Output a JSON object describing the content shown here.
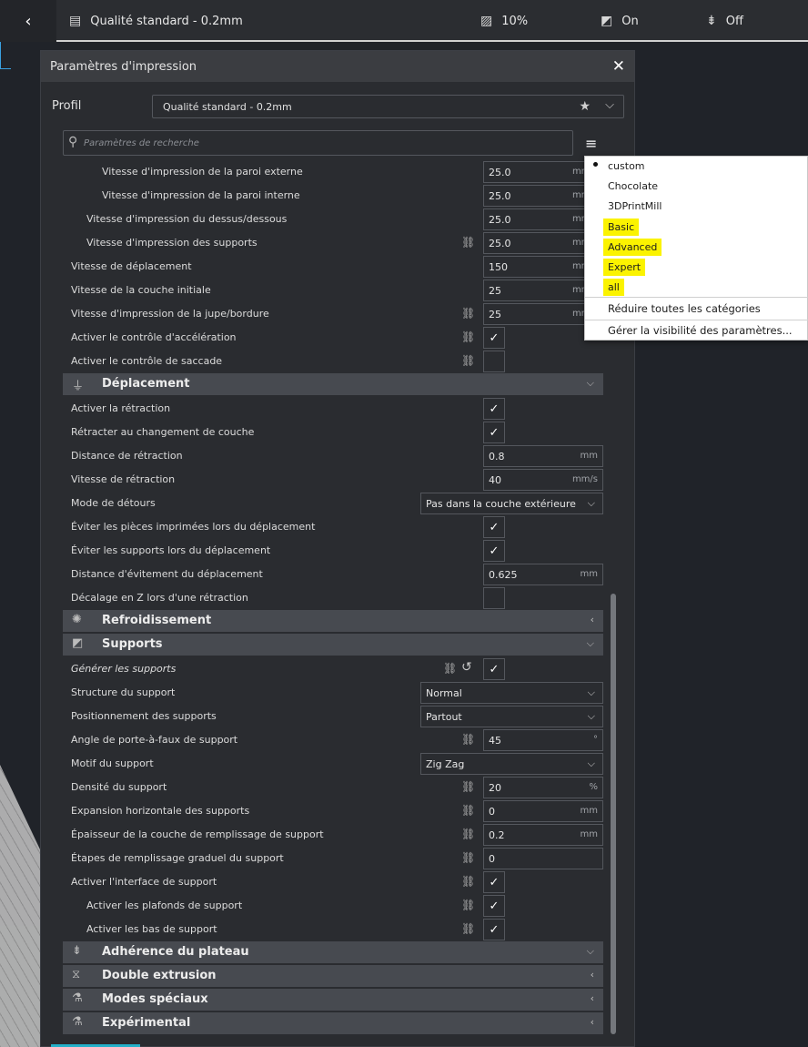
{
  "topbar": {
    "profile": "Qualité standard - 0.2mm",
    "infill": "10%",
    "support": "On",
    "adhesion": "Off"
  },
  "dialog": {
    "title": "Paramètres d'impression",
    "profile_label": "Profil",
    "profile_value": "Qualité standard - 0.2mm",
    "search_placeholder": "Paramètres de recherche"
  },
  "settings": [
    {
      "label": "Vitesse d'impression de la paroi externe",
      "value": "25.0",
      "unit": "mm/s"
    },
    {
      "label": "Vitesse d'impression de la paroi interne",
      "value": "25.0",
      "unit": "mm/s"
    },
    {
      "label": "Vitesse d'impression du dessus/dessous",
      "value": "25.0",
      "unit": "mm/s"
    },
    {
      "label": "Vitesse d'impression des supports",
      "value": "25.0",
      "unit": "mm/s"
    },
    {
      "label": "Vitesse de déplacement",
      "value": "150",
      "unit": "mm/s"
    },
    {
      "label": "Vitesse de la couche initiale",
      "value": "25",
      "unit": "mm/s"
    },
    {
      "label": "Vitesse d'impression de la jupe/bordure",
      "value": "25",
      "unit": "mm/s"
    },
    {
      "label": "Activer le contrôle d'accélération"
    },
    {
      "label": "Activer le contrôle de saccade"
    },
    {
      "label": "Activer la rétraction"
    },
    {
      "label": "Rétracter au changement de couche"
    },
    {
      "label": "Distance de rétraction",
      "value": "0.8",
      "unit": "mm"
    },
    {
      "label": "Vitesse de rétraction",
      "value": "40",
      "unit": "mm/s"
    },
    {
      "label": "Mode de détours",
      "value": "Pas dans la couche extérieure"
    },
    {
      "label": "Éviter les pièces imprimées lors du déplacement"
    },
    {
      "label": "Éviter les supports lors du déplacement"
    },
    {
      "label": "Distance d'évitement du déplacement",
      "value": "0.625",
      "unit": "mm"
    },
    {
      "label": "Décalage en Z lors d'une rétraction"
    },
    {
      "label": "Générer les supports"
    },
    {
      "label": "Structure du support",
      "value": "Normal"
    },
    {
      "label": "Positionnement des supports",
      "value": "Partout"
    },
    {
      "label": "Angle de porte-à-faux de support",
      "value": "45",
      "unit": "°"
    },
    {
      "label": "Motif du support",
      "value": "Zig Zag"
    },
    {
      "label": "Densité du support",
      "value": "20",
      "unit": "%"
    },
    {
      "label": "Expansion horizontale des supports",
      "value": "0",
      "unit": "mm"
    },
    {
      "label": "Épaisseur de la couche de remplissage de support",
      "value": "0.2",
      "unit": "mm"
    },
    {
      "label": "Étapes de remplissage graduel du support",
      "value": "0"
    },
    {
      "label": "Activer l'interface de support"
    },
    {
      "label": "Activer les plafonds de support"
    },
    {
      "label": "Activer les bas de support"
    }
  ],
  "categories": {
    "travel": "Déplacement",
    "cooling": "Refroidissement",
    "support": "Supports",
    "adhesion": "Adhérence du plateau",
    "dual": "Double extrusion",
    "special": "Modes spéciaux",
    "experimental": "Expérimental"
  },
  "menu": {
    "items": [
      "custom",
      "Chocolate",
      "3DPrintMill",
      "Basic",
      "Advanced",
      "Expert",
      "all"
    ],
    "collapse_all": "Réduire toutes les catégories",
    "manage_visibility": "Gérer la visibilité des paramètres..."
  }
}
